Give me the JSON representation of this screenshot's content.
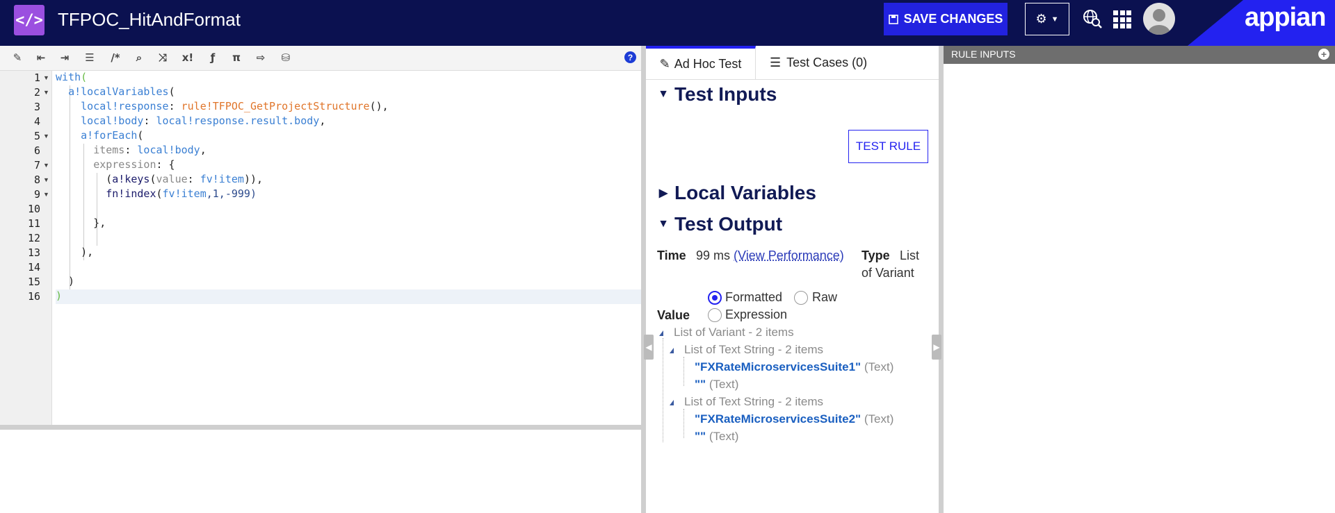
{
  "header": {
    "app_icon": "code-icon",
    "title": "TFPOC_HitAndFormat",
    "save_label": "SAVE CHANGES",
    "brand": "appian"
  },
  "editor": {
    "line_numbers": [
      "1",
      "2",
      "3",
      "4",
      "5",
      "6",
      "7",
      "8",
      "9",
      "10",
      "11",
      "12",
      "13",
      "14",
      "15",
      "16"
    ],
    "lines": [
      [
        {
          "t": "with",
          "c": "k"
        },
        {
          "t": "(",
          "c": "g"
        }
      ],
      [
        {
          "t": "  ",
          "c": "d"
        },
        {
          "t": "a!localVariables",
          "c": "k"
        },
        {
          "t": "(",
          "c": "d"
        }
      ],
      [
        {
          "t": "    ",
          "c": "d"
        },
        {
          "t": "local!response",
          "c": "k"
        },
        {
          "t": ": ",
          "c": "d"
        },
        {
          "t": "rule!TFPOC_GetProjectStructure",
          "c": "r"
        },
        {
          "t": "(),",
          "c": "d"
        }
      ],
      [
        {
          "t": "    ",
          "c": "d"
        },
        {
          "t": "local!body",
          "c": "k"
        },
        {
          "t": ": ",
          "c": "d"
        },
        {
          "t": "local!response.result.body",
          "c": "k"
        },
        {
          "t": ",",
          "c": "d"
        }
      ],
      [
        {
          "t": "    ",
          "c": "d"
        },
        {
          "t": "a!forEach",
          "c": "k"
        },
        {
          "t": "(",
          "c": "d"
        }
      ],
      [
        {
          "t": "      ",
          "c": "d"
        },
        {
          "t": "items",
          "c": "p"
        },
        {
          "t": ": ",
          "c": "d"
        },
        {
          "t": "local!body",
          "c": "k"
        },
        {
          "t": ",",
          "c": "d"
        }
      ],
      [
        {
          "t": "      ",
          "c": "d"
        },
        {
          "t": "expression",
          "c": "p"
        },
        {
          "t": ": {",
          "c": "d"
        }
      ],
      [
        {
          "t": "        (",
          "c": "d"
        },
        {
          "t": "a!keys",
          "c": "v"
        },
        {
          "t": "(",
          "c": "d"
        },
        {
          "t": "value",
          "c": "p"
        },
        {
          "t": ": ",
          "c": "d"
        },
        {
          "t": "fv!item",
          "c": "k"
        },
        {
          "t": ")),",
          "c": "d"
        }
      ],
      [
        {
          "t": "        ",
          "c": "d"
        },
        {
          "t": "fn!index",
          "c": "v"
        },
        {
          "t": "(",
          "c": "d"
        },
        {
          "t": "fv!item",
          "c": "k"
        },
        {
          "t": ",1,-999)",
          "c": "n"
        }
      ],
      [],
      [
        {
          "t": "      },",
          "c": "d"
        }
      ],
      [],
      [
        {
          "t": "    ),",
          "c": "d"
        }
      ],
      [],
      [
        {
          "t": "  )",
          "c": "d"
        }
      ],
      [
        {
          "t": ")",
          "c": "g"
        }
      ]
    ]
  },
  "tabs": {
    "adhoc": "Ad Hoc Test",
    "cases": "Test Cases (0)"
  },
  "test_panel": {
    "test_inputs": "Test Inputs",
    "test_rule": "TEST RULE",
    "local_variables": "Local Variables",
    "test_output": "Test Output",
    "time_label": "Time",
    "time_value": "99 ms",
    "view_performance": "(View Performance)",
    "type_label": "Type",
    "type_value_1": "List",
    "type_value_2": "of Variant",
    "value_label": "Value",
    "radio_formatted": "Formatted",
    "radio_raw": "Raw",
    "radio_expression": "Expression",
    "selected_format": "Formatted"
  },
  "tree": {
    "root": "List of Variant - 2 items",
    "group1": "List of Text String - 2 items",
    "g1_item1": "\"FXRateMicroservicesSuite1\"",
    "g1_item1_type": "(Text)",
    "g1_item2": "\"\"",
    "g1_item2_type": "(Text)",
    "group2": "List of Text String - 2 items",
    "g2_item1": "\"FXRateMicroservicesSuite2\"",
    "g2_item1_type": "(Text)",
    "g2_item2": "\"\"",
    "g2_item2_type": "(Text)"
  },
  "rule_inputs": {
    "header": "RULE INPUTS"
  }
}
